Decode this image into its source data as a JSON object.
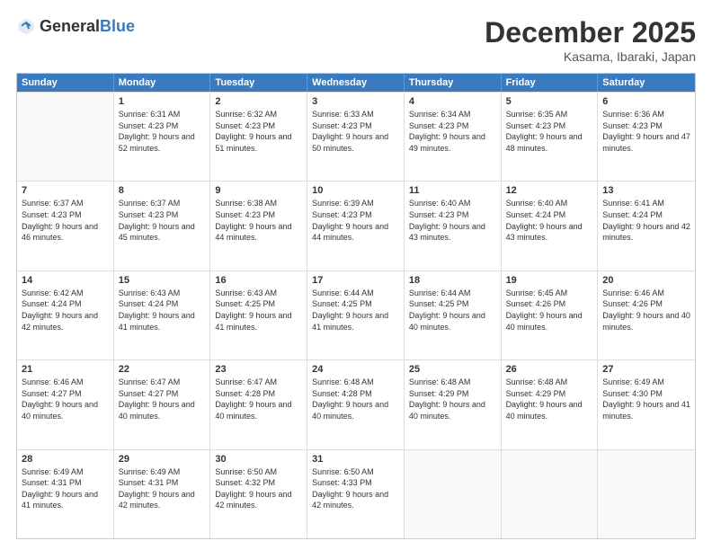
{
  "header": {
    "logo_general": "General",
    "logo_blue": "Blue",
    "month": "December 2025",
    "location": "Kasama, Ibaraki, Japan"
  },
  "weekdays": [
    "Sunday",
    "Monday",
    "Tuesday",
    "Wednesday",
    "Thursday",
    "Friday",
    "Saturday"
  ],
  "weeks": [
    [
      {
        "day": "",
        "sunrise": "",
        "sunset": "",
        "daylight": ""
      },
      {
        "day": "1",
        "sunrise": "Sunrise: 6:31 AM",
        "sunset": "Sunset: 4:23 PM",
        "daylight": "Daylight: 9 hours and 52 minutes."
      },
      {
        "day": "2",
        "sunrise": "Sunrise: 6:32 AM",
        "sunset": "Sunset: 4:23 PM",
        "daylight": "Daylight: 9 hours and 51 minutes."
      },
      {
        "day": "3",
        "sunrise": "Sunrise: 6:33 AM",
        "sunset": "Sunset: 4:23 PM",
        "daylight": "Daylight: 9 hours and 50 minutes."
      },
      {
        "day": "4",
        "sunrise": "Sunrise: 6:34 AM",
        "sunset": "Sunset: 4:23 PM",
        "daylight": "Daylight: 9 hours and 49 minutes."
      },
      {
        "day": "5",
        "sunrise": "Sunrise: 6:35 AM",
        "sunset": "Sunset: 4:23 PM",
        "daylight": "Daylight: 9 hours and 48 minutes."
      },
      {
        "day": "6",
        "sunrise": "Sunrise: 6:36 AM",
        "sunset": "Sunset: 4:23 PM",
        "daylight": "Daylight: 9 hours and 47 minutes."
      }
    ],
    [
      {
        "day": "7",
        "sunrise": "Sunrise: 6:37 AM",
        "sunset": "Sunset: 4:23 PM",
        "daylight": "Daylight: 9 hours and 46 minutes."
      },
      {
        "day": "8",
        "sunrise": "Sunrise: 6:37 AM",
        "sunset": "Sunset: 4:23 PM",
        "daylight": "Daylight: 9 hours and 45 minutes."
      },
      {
        "day": "9",
        "sunrise": "Sunrise: 6:38 AM",
        "sunset": "Sunset: 4:23 PM",
        "daylight": "Daylight: 9 hours and 44 minutes."
      },
      {
        "day": "10",
        "sunrise": "Sunrise: 6:39 AM",
        "sunset": "Sunset: 4:23 PM",
        "daylight": "Daylight: 9 hours and 44 minutes."
      },
      {
        "day": "11",
        "sunrise": "Sunrise: 6:40 AM",
        "sunset": "Sunset: 4:23 PM",
        "daylight": "Daylight: 9 hours and 43 minutes."
      },
      {
        "day": "12",
        "sunrise": "Sunrise: 6:40 AM",
        "sunset": "Sunset: 4:24 PM",
        "daylight": "Daylight: 9 hours and 43 minutes."
      },
      {
        "day": "13",
        "sunrise": "Sunrise: 6:41 AM",
        "sunset": "Sunset: 4:24 PM",
        "daylight": "Daylight: 9 hours and 42 minutes."
      }
    ],
    [
      {
        "day": "14",
        "sunrise": "Sunrise: 6:42 AM",
        "sunset": "Sunset: 4:24 PM",
        "daylight": "Daylight: 9 hours and 42 minutes."
      },
      {
        "day": "15",
        "sunrise": "Sunrise: 6:43 AM",
        "sunset": "Sunset: 4:24 PM",
        "daylight": "Daylight: 9 hours and 41 minutes."
      },
      {
        "day": "16",
        "sunrise": "Sunrise: 6:43 AM",
        "sunset": "Sunset: 4:25 PM",
        "daylight": "Daylight: 9 hours and 41 minutes."
      },
      {
        "day": "17",
        "sunrise": "Sunrise: 6:44 AM",
        "sunset": "Sunset: 4:25 PM",
        "daylight": "Daylight: 9 hours and 41 minutes."
      },
      {
        "day": "18",
        "sunrise": "Sunrise: 6:44 AM",
        "sunset": "Sunset: 4:25 PM",
        "daylight": "Daylight: 9 hours and 40 minutes."
      },
      {
        "day": "19",
        "sunrise": "Sunrise: 6:45 AM",
        "sunset": "Sunset: 4:26 PM",
        "daylight": "Daylight: 9 hours and 40 minutes."
      },
      {
        "day": "20",
        "sunrise": "Sunrise: 6:46 AM",
        "sunset": "Sunset: 4:26 PM",
        "daylight": "Daylight: 9 hours and 40 minutes."
      }
    ],
    [
      {
        "day": "21",
        "sunrise": "Sunrise: 6:46 AM",
        "sunset": "Sunset: 4:27 PM",
        "daylight": "Daylight: 9 hours and 40 minutes."
      },
      {
        "day": "22",
        "sunrise": "Sunrise: 6:47 AM",
        "sunset": "Sunset: 4:27 PM",
        "daylight": "Daylight: 9 hours and 40 minutes."
      },
      {
        "day": "23",
        "sunrise": "Sunrise: 6:47 AM",
        "sunset": "Sunset: 4:28 PM",
        "daylight": "Daylight: 9 hours and 40 minutes."
      },
      {
        "day": "24",
        "sunrise": "Sunrise: 6:48 AM",
        "sunset": "Sunset: 4:28 PM",
        "daylight": "Daylight: 9 hours and 40 minutes."
      },
      {
        "day": "25",
        "sunrise": "Sunrise: 6:48 AM",
        "sunset": "Sunset: 4:29 PM",
        "daylight": "Daylight: 9 hours and 40 minutes."
      },
      {
        "day": "26",
        "sunrise": "Sunrise: 6:48 AM",
        "sunset": "Sunset: 4:29 PM",
        "daylight": "Daylight: 9 hours and 40 minutes."
      },
      {
        "day": "27",
        "sunrise": "Sunrise: 6:49 AM",
        "sunset": "Sunset: 4:30 PM",
        "daylight": "Daylight: 9 hours and 41 minutes."
      }
    ],
    [
      {
        "day": "28",
        "sunrise": "Sunrise: 6:49 AM",
        "sunset": "Sunset: 4:31 PM",
        "daylight": "Daylight: 9 hours and 41 minutes."
      },
      {
        "day": "29",
        "sunrise": "Sunrise: 6:49 AM",
        "sunset": "Sunset: 4:31 PM",
        "daylight": "Daylight: 9 hours and 42 minutes."
      },
      {
        "day": "30",
        "sunrise": "Sunrise: 6:50 AM",
        "sunset": "Sunset: 4:32 PM",
        "daylight": "Daylight: 9 hours and 42 minutes."
      },
      {
        "day": "31",
        "sunrise": "Sunrise: 6:50 AM",
        "sunset": "Sunset: 4:33 PM",
        "daylight": "Daylight: 9 hours and 42 minutes."
      },
      {
        "day": "",
        "sunrise": "",
        "sunset": "",
        "daylight": ""
      },
      {
        "day": "",
        "sunrise": "",
        "sunset": "",
        "daylight": ""
      },
      {
        "day": "",
        "sunrise": "",
        "sunset": "",
        "daylight": ""
      }
    ]
  ]
}
